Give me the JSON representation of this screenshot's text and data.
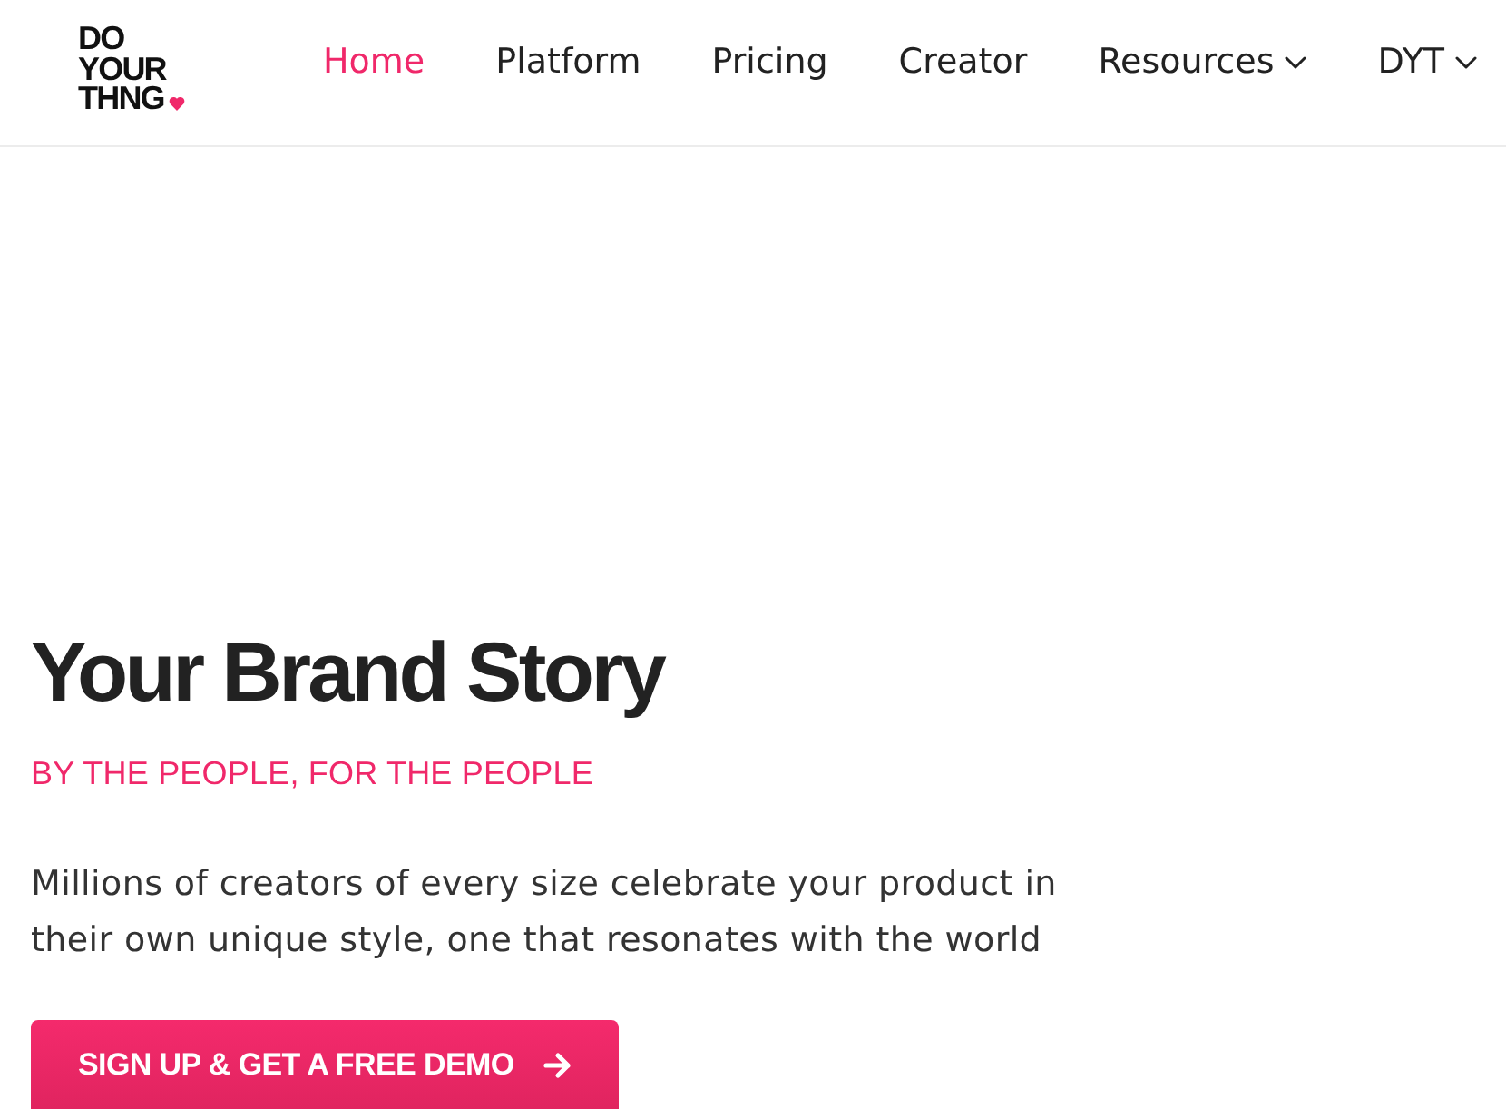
{
  "header": {
    "logo": {
      "lines": [
        "DO",
        "YOUR",
        "THNG"
      ]
    },
    "nav": [
      {
        "label": "Home",
        "kind": "link",
        "selected": true
      },
      {
        "label": "Platform",
        "kind": "link",
        "selected": false
      },
      {
        "label": "Pricing",
        "kind": "link",
        "selected": false
      },
      {
        "label": "Creator",
        "kind": "link",
        "selected": false
      },
      {
        "label": "Resources",
        "kind": "dropdown",
        "selected": false
      },
      {
        "label": "DYT",
        "kind": "dropdown",
        "selected": false
      }
    ]
  },
  "hero": {
    "title": "Your Brand Story",
    "tagline": "BY THE PEOPLE, FOR THE PEOPLE",
    "description": "Millions of creators of every size celebrate your product in their own unique style, one that resonates with the world",
    "cta": {
      "label": "SIGN UP & GET A FREE DEMO"
    }
  }
}
